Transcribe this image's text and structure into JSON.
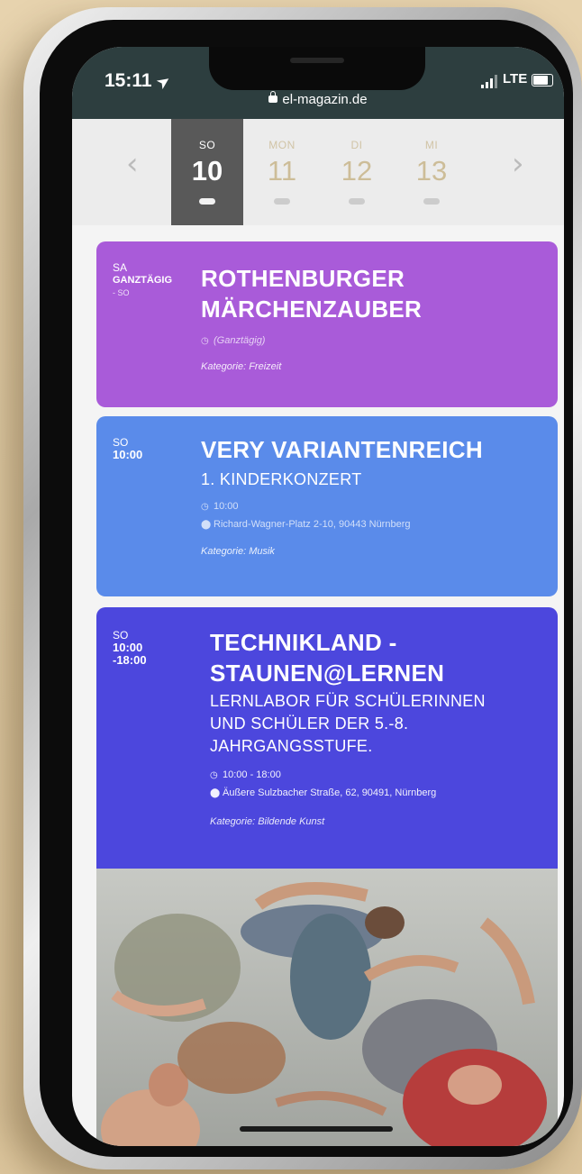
{
  "status_bar": {
    "time": "15:11",
    "network": "LTE"
  },
  "browser": {
    "url": "el-magazin.de"
  },
  "date_nav": {
    "prev_arrow": "‹",
    "next_arrow": "›",
    "days": [
      {
        "weekday": "SO",
        "day": "10"
      },
      {
        "weekday": "MON",
        "day": "11"
      },
      {
        "weekday": "DI",
        "day": "12"
      },
      {
        "weekday": "MI",
        "day": "13"
      }
    ]
  },
  "events": [
    {
      "day_label": "SA",
      "time_label": "GANZTÄGIG",
      "end_label": "- SO",
      "title_lines": [
        "ROTHENBURGER",
        "MÄRCHENZAUBER"
      ],
      "time_text": "(Ganztägig)",
      "category": "Kategorie:  Freizeit",
      "color": "#a95bd9"
    },
    {
      "day_label": "SO",
      "time_label": "10:00",
      "title_lines": [
        "VERY VARIANTENREICH"
      ],
      "subtitle_lines": [
        "1. KINDERKONZERT"
      ],
      "time_text": "10:00",
      "location": "Richard-Wagner-Platz 2-10, 90443 Nürnberg",
      "category": "Kategorie:  Musik",
      "color": "#5a8bea"
    },
    {
      "day_label": "SO",
      "time_label": "10:00",
      "end_label": "-18:00",
      "title_lines": [
        "TECHNIKLAND -",
        "STAUNEN@LERNEN"
      ],
      "subtitle_lines": [
        "LERNLABOR FÜR SCHÜLERINNEN",
        "UND SCHÜLER DER 5.-8.",
        "JAHRGANGSSTUFE."
      ],
      "time_text": "10:00 - 18:00",
      "location": "Äußere Sulzbacher Straße, 62, 90491, Nürnberg",
      "category": "Kategorie:  Bildende Kunst",
      "color": "#4c47dd"
    }
  ],
  "icons": {
    "clock": "clock-icon",
    "location": "map-pin-icon",
    "lock": "lock-icon"
  }
}
